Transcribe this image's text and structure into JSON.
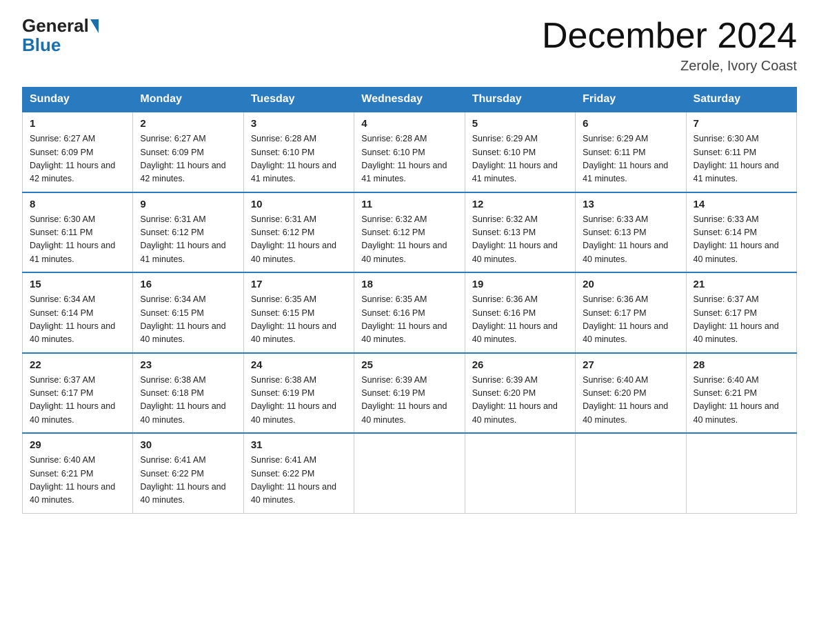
{
  "header": {
    "logo_general": "General",
    "logo_blue": "Blue",
    "title": "December 2024",
    "location": "Zerole, Ivory Coast"
  },
  "columns": [
    "Sunday",
    "Monday",
    "Tuesday",
    "Wednesday",
    "Thursday",
    "Friday",
    "Saturday"
  ],
  "weeks": [
    [
      {
        "day": "1",
        "sunrise": "6:27 AM",
        "sunset": "6:09 PM",
        "daylight": "11 hours and 42 minutes."
      },
      {
        "day": "2",
        "sunrise": "6:27 AM",
        "sunset": "6:09 PM",
        "daylight": "11 hours and 42 minutes."
      },
      {
        "day": "3",
        "sunrise": "6:28 AM",
        "sunset": "6:10 PM",
        "daylight": "11 hours and 41 minutes."
      },
      {
        "day": "4",
        "sunrise": "6:28 AM",
        "sunset": "6:10 PM",
        "daylight": "11 hours and 41 minutes."
      },
      {
        "day": "5",
        "sunrise": "6:29 AM",
        "sunset": "6:10 PM",
        "daylight": "11 hours and 41 minutes."
      },
      {
        "day": "6",
        "sunrise": "6:29 AM",
        "sunset": "6:11 PM",
        "daylight": "11 hours and 41 minutes."
      },
      {
        "day": "7",
        "sunrise": "6:30 AM",
        "sunset": "6:11 PM",
        "daylight": "11 hours and 41 minutes."
      }
    ],
    [
      {
        "day": "8",
        "sunrise": "6:30 AM",
        "sunset": "6:11 PM",
        "daylight": "11 hours and 41 minutes."
      },
      {
        "day": "9",
        "sunrise": "6:31 AM",
        "sunset": "6:12 PM",
        "daylight": "11 hours and 41 minutes."
      },
      {
        "day": "10",
        "sunrise": "6:31 AM",
        "sunset": "6:12 PM",
        "daylight": "11 hours and 40 minutes."
      },
      {
        "day": "11",
        "sunrise": "6:32 AM",
        "sunset": "6:12 PM",
        "daylight": "11 hours and 40 minutes."
      },
      {
        "day": "12",
        "sunrise": "6:32 AM",
        "sunset": "6:13 PM",
        "daylight": "11 hours and 40 minutes."
      },
      {
        "day": "13",
        "sunrise": "6:33 AM",
        "sunset": "6:13 PM",
        "daylight": "11 hours and 40 minutes."
      },
      {
        "day": "14",
        "sunrise": "6:33 AM",
        "sunset": "6:14 PM",
        "daylight": "11 hours and 40 minutes."
      }
    ],
    [
      {
        "day": "15",
        "sunrise": "6:34 AM",
        "sunset": "6:14 PM",
        "daylight": "11 hours and 40 minutes."
      },
      {
        "day": "16",
        "sunrise": "6:34 AM",
        "sunset": "6:15 PM",
        "daylight": "11 hours and 40 minutes."
      },
      {
        "day": "17",
        "sunrise": "6:35 AM",
        "sunset": "6:15 PM",
        "daylight": "11 hours and 40 minutes."
      },
      {
        "day": "18",
        "sunrise": "6:35 AM",
        "sunset": "6:16 PM",
        "daylight": "11 hours and 40 minutes."
      },
      {
        "day": "19",
        "sunrise": "6:36 AM",
        "sunset": "6:16 PM",
        "daylight": "11 hours and 40 minutes."
      },
      {
        "day": "20",
        "sunrise": "6:36 AM",
        "sunset": "6:17 PM",
        "daylight": "11 hours and 40 minutes."
      },
      {
        "day": "21",
        "sunrise": "6:37 AM",
        "sunset": "6:17 PM",
        "daylight": "11 hours and 40 minutes."
      }
    ],
    [
      {
        "day": "22",
        "sunrise": "6:37 AM",
        "sunset": "6:17 PM",
        "daylight": "11 hours and 40 minutes."
      },
      {
        "day": "23",
        "sunrise": "6:38 AM",
        "sunset": "6:18 PM",
        "daylight": "11 hours and 40 minutes."
      },
      {
        "day": "24",
        "sunrise": "6:38 AM",
        "sunset": "6:19 PM",
        "daylight": "11 hours and 40 minutes."
      },
      {
        "day": "25",
        "sunrise": "6:39 AM",
        "sunset": "6:19 PM",
        "daylight": "11 hours and 40 minutes."
      },
      {
        "day": "26",
        "sunrise": "6:39 AM",
        "sunset": "6:20 PM",
        "daylight": "11 hours and 40 minutes."
      },
      {
        "day": "27",
        "sunrise": "6:40 AM",
        "sunset": "6:20 PM",
        "daylight": "11 hours and 40 minutes."
      },
      {
        "day": "28",
        "sunrise": "6:40 AM",
        "sunset": "6:21 PM",
        "daylight": "11 hours and 40 minutes."
      }
    ],
    [
      {
        "day": "29",
        "sunrise": "6:40 AM",
        "sunset": "6:21 PM",
        "daylight": "11 hours and 40 minutes."
      },
      {
        "day": "30",
        "sunrise": "6:41 AM",
        "sunset": "6:22 PM",
        "daylight": "11 hours and 40 minutes."
      },
      {
        "day": "31",
        "sunrise": "6:41 AM",
        "sunset": "6:22 PM",
        "daylight": "11 hours and 40 minutes."
      },
      null,
      null,
      null,
      null
    ]
  ]
}
